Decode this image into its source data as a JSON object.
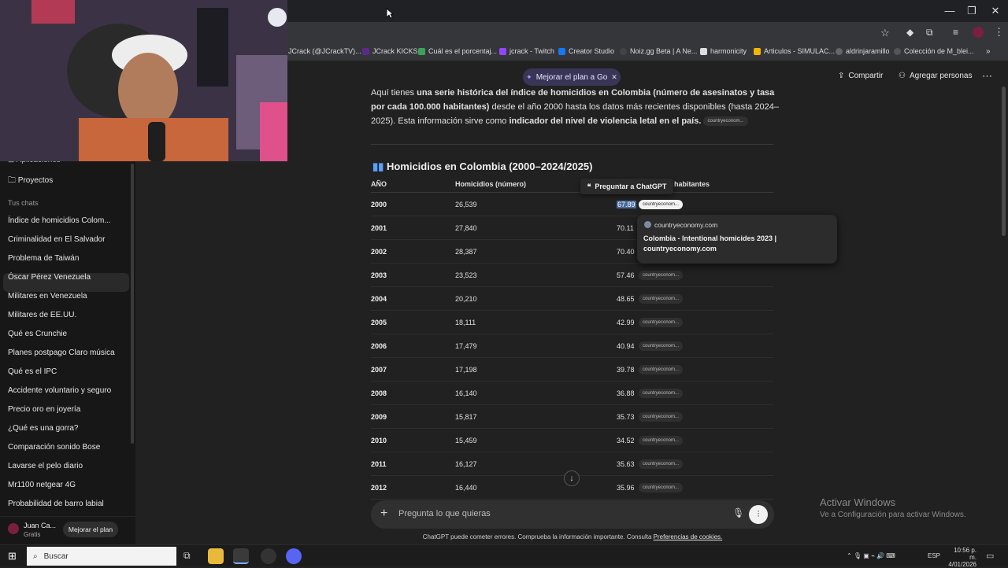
{
  "browser": {
    "bookmarks": [
      "JCrack (@JCrackTV)...",
      "JCrack KICKS",
      "Cuál es el porcentaj...",
      "jcrack - Twitch",
      "Creator Studio",
      "Noiz.gg Beta | A Ne...",
      "harmonicity",
      "Articulos - SIMULAC...",
      "aldrinjaramillo",
      "Colección de M_blei..."
    ]
  },
  "topbar": {
    "upgrade_pill": "Mejorar el plan a Go",
    "share": "Compartir",
    "add_people": "Agregar personas"
  },
  "sidebar": {
    "apps": "Aplicaciones",
    "projects": "Proyectos",
    "section": "Tus chats",
    "chats": [
      "Índice de homicidios Colom...",
      "Criminalidad en El Salvador",
      "Problema de Taiwán",
      "Óscar Pérez Venezuela",
      "Militares en Venezuela",
      "Militares de EE.UU.",
      "Qué es Crunchie",
      "Planes postpago Claro música",
      "Qué es el IPC",
      "Accidente voluntario y seguro",
      "Precio oro en joyería",
      "¿Qué es una gorra?",
      "Comparación sonido Bose",
      "Lavarse el pelo diario",
      "Mr1100 netgear 4G",
      "Probabilidad de barro labial"
    ],
    "user_name": "Juan Ca...",
    "user_plan": "Gratis",
    "upgrade": "Mejorar el plan"
  },
  "content": {
    "p1": "Aquí tienes",
    "p1b": "una serie histórica del índice de homicidios en Colombia (número de asesinatos y tasa por cada 100.000 habitantes)",
    "p2": "desde el año 2000 hasta los datos más recientes disponibles (hasta 2024–2025). Esta información sirve como",
    "p2b": "indicador del nivel de violencia letal en el país.",
    "chip": "countryeconom...",
    "heading": "Homicidios en Colombia (2000–2024/2025)",
    "col_year": "AÑO",
    "col_num": "Homicidios (número)",
    "col_rate": "habitantes",
    "tooltip": "Preguntar a ChatGPT",
    "rows": [
      {
        "year": "2000",
        "num": "26,539",
        "rate": "67.89"
      },
      {
        "year": "2001",
        "num": "27,840",
        "rate": "70.11"
      },
      {
        "year": "2002",
        "num": "28,387",
        "rate": "70.40"
      },
      {
        "year": "2003",
        "num": "23,523",
        "rate": "57.46"
      },
      {
        "year": "2004",
        "num": "20,210",
        "rate": "48.65"
      },
      {
        "year": "2005",
        "num": "18,111",
        "rate": "42.99"
      },
      {
        "year": "2006",
        "num": "17,479",
        "rate": "40.94"
      },
      {
        "year": "2007",
        "num": "17,198",
        "rate": "39.78"
      },
      {
        "year": "2008",
        "num": "16,140",
        "rate": "36.88"
      },
      {
        "year": "2009",
        "num": "15,817",
        "rate": "35.73"
      },
      {
        "year": "2010",
        "num": "15,459",
        "rate": "34.52"
      },
      {
        "year": "2011",
        "num": "16,127",
        "rate": "35.63"
      },
      {
        "year": "2012",
        "num": "16,440",
        "rate": "35.96"
      }
    ],
    "popover_site": "countryeconomy.com",
    "popover_title": "Colombia - Intentional homicides 2023 | countryeconomy.com"
  },
  "composer": {
    "placeholder": "Pregunta lo que quieras"
  },
  "footer": {
    "text": "ChatGPT puede cometer errores. Comprueba la información importante. Consulta",
    "link": "Preferencias de cookies."
  },
  "watermark": {
    "title": "Activar Windows",
    "sub": "Ve a Configuración para activar Windows."
  },
  "taskbar": {
    "search": "Buscar",
    "lang": "ESP",
    "time": "10:56 p. m.",
    "date": "4/01/2026"
  }
}
